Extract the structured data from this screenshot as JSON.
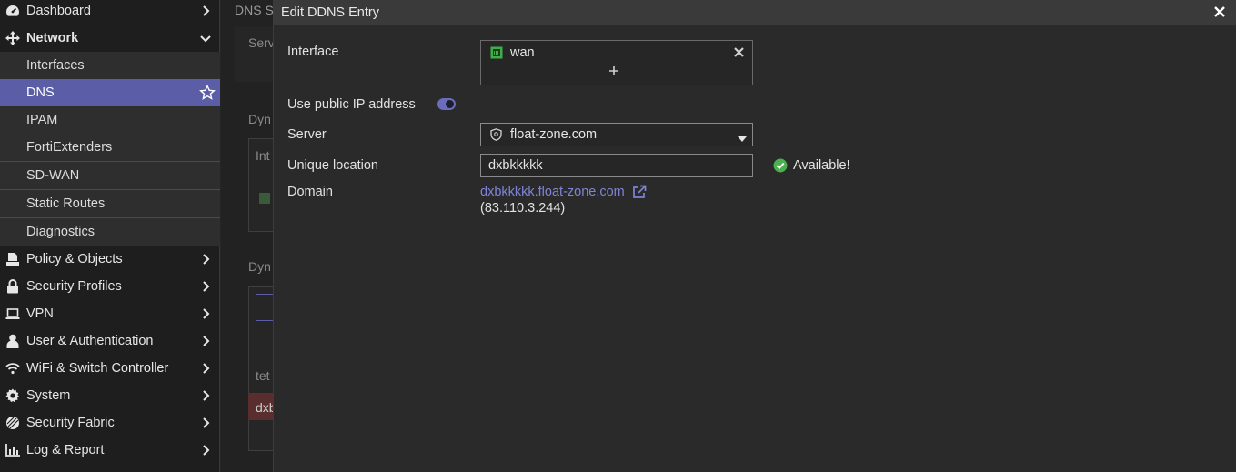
{
  "sidebar": {
    "top_items": [
      {
        "label": "Dashboard",
        "icon": "dashboard-icon"
      },
      {
        "label": "Network",
        "icon": "network-icon"
      }
    ],
    "network_sub": [
      {
        "label": "Interfaces"
      },
      {
        "label": "DNS",
        "active": true
      },
      {
        "label": "IPAM"
      },
      {
        "label": "FortiExtenders"
      },
      {
        "label": "SD-WAN"
      },
      {
        "label": "Static Routes"
      },
      {
        "label": "Diagnostics"
      }
    ],
    "bottom_items": [
      {
        "label": "Policy & Objects",
        "icon": "policy-icon"
      },
      {
        "label": "Security Profiles",
        "icon": "lock-icon"
      },
      {
        "label": "VPN",
        "icon": "laptop-icon"
      },
      {
        "label": "User & Authentication",
        "icon": "user-icon"
      },
      {
        "label": "WiFi & Switch Controller",
        "icon": "wifi-icon"
      },
      {
        "label": "System",
        "icon": "gear-icon"
      },
      {
        "label": "Security Fabric",
        "icon": "fabric-icon"
      },
      {
        "label": "Log & Report",
        "icon": "chart-icon"
      }
    ]
  },
  "background": {
    "tab": "DNS S",
    "texts": [
      "Serv",
      "Dyn",
      "Int",
      "Dyn",
      "tet",
      "dxb"
    ]
  },
  "modal": {
    "title": "Edit DDNS Entry",
    "interface_label": "Interface",
    "interface_value": "wan",
    "public_ip_label": "Use public IP address",
    "public_ip_enabled": true,
    "server_label": "Server",
    "server_value": "float-zone.com",
    "unique_location_label": "Unique location",
    "unique_location_value": "dxbkkkkk",
    "available_text": "Available!",
    "domain_label": "Domain",
    "domain_value": "dxbkkkkk.float-zone.com",
    "domain_ip": "(83.110.3.244)"
  },
  "colors": {
    "accent": "#5b5ea6",
    "link": "#7f84d6",
    "success": "#4caf50",
    "port": "#3fae49"
  }
}
